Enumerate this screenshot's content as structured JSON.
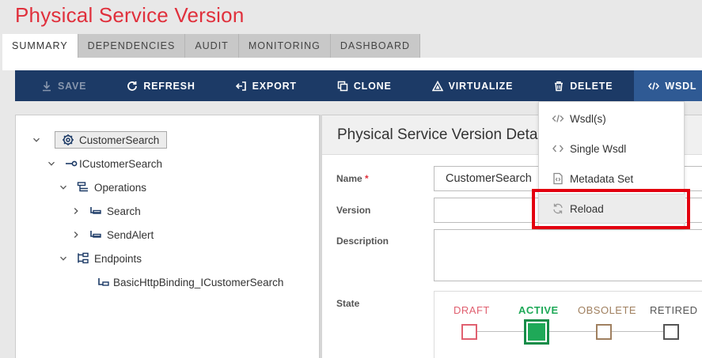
{
  "page_title": "Physical Service Version",
  "tabs": [
    {
      "label": "SUMMARY",
      "active": true
    },
    {
      "label": "DEPENDENCIES",
      "active": false
    },
    {
      "label": "AUDIT",
      "active": false
    },
    {
      "label": "MONITORING",
      "active": false
    },
    {
      "label": "DASHBOARD",
      "active": false
    }
  ],
  "toolbar": {
    "save": "SAVE",
    "refresh": "REFRESH",
    "export": "EXPORT",
    "clone": "CLONE",
    "virtualize": "VIRTUALIZE",
    "delete": "DELETE",
    "wsdl": "WSDL"
  },
  "tree": {
    "root": "CustomerSearch",
    "interface": "ICustomerSearch",
    "operations": "Operations",
    "operation_items": [
      "Search",
      "SendAlert"
    ],
    "endpoints": "Endpoints",
    "endpoint_items": [
      "BasicHttpBinding_ICustomerSearch"
    ]
  },
  "details": {
    "title": "Physical Service Version Details",
    "name_label": "Name",
    "name_required": "*",
    "name_value": "CustomerSearch",
    "version_label": "Version",
    "version_value": "",
    "description_label": "Description",
    "state_label": "State",
    "states": [
      "DRAFT",
      "ACTIVE",
      "OBSOLETE",
      "RETIRED"
    ],
    "active_state": "ACTIVE"
  },
  "wsdl_menu": {
    "items": [
      "Wsdl(s)",
      "Single Wsdl",
      "Metadata Set",
      "Reload"
    ]
  },
  "colors": {
    "title_red": "#e0303c",
    "toolbar_navy": "#1c3a66",
    "wsdl_active": "#2f5a94",
    "active_green": "#1fa958",
    "draft_red": "#e06070",
    "obsolete_brown": "#a08060",
    "highlight_red": "#e3000f"
  }
}
